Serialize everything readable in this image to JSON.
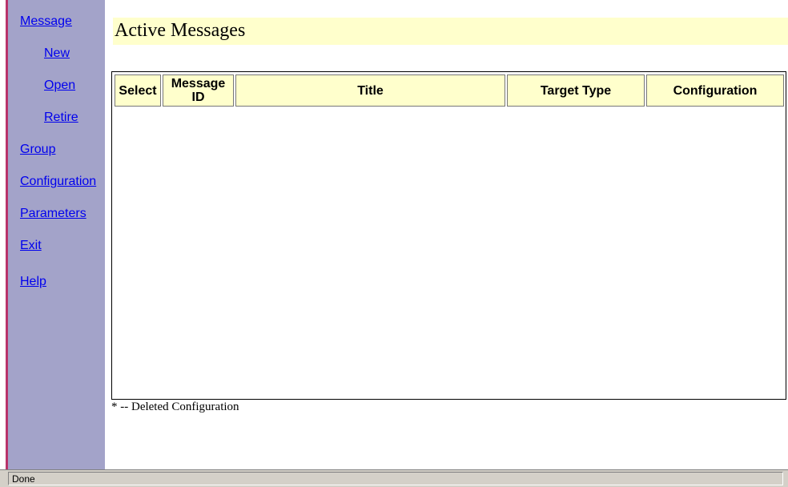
{
  "sidebar": {
    "links": [
      "Message",
      "New",
      "Open",
      "Retire",
      "Group",
      "Configuration",
      "Parameters",
      "Exit",
      "Help"
    ]
  },
  "main": {
    "title": "Active Messages",
    "table": {
      "headers": [
        "Select",
        "Message ID",
        "Title",
        "Target Type",
        "Configuration"
      ],
      "rows": []
    },
    "legend": "* -- Deleted Configuration"
  },
  "statusbar": {
    "text": "Done"
  },
  "colors": {
    "sidebar_bg": "#a3a3c9",
    "header_bg": "#ffffcc",
    "link": "#0000ee",
    "accent_edge": "#b8336a"
  }
}
